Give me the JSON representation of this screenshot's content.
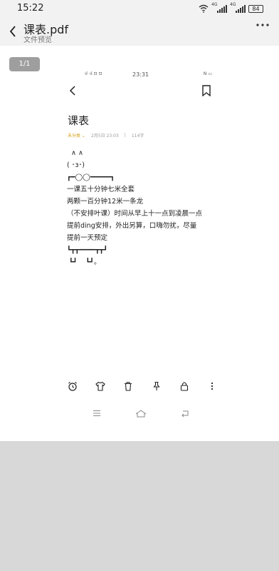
{
  "status_bar": {
    "time": "15:22",
    "signal_1_label": "4G",
    "signal_2_label": "4G",
    "battery": "84"
  },
  "header": {
    "title": "课表.pdf",
    "subtitle": "文件预览"
  },
  "page_indicator": "1/1",
  "inner_phone": {
    "status_time": "23:31",
    "status_left": "ᐧıl ᐧıl ⊡ ⊡",
    "status_right": "N ▭"
  },
  "note": {
    "title": "课表",
    "category": "未分类",
    "date": "2月5日 23:03",
    "separator": "|",
    "word_count": "114字",
    "lines": [
      "  ∧ ∧",
      "( ･з･)",
      "┏━◯◯━━━━━┓",
      "一课五十分钟七米全套",
      "两颗一百分钟12米一条龙",
      "（不安排叶课）时间从早上十一点到凌晨一点",
      "提前ding安排，外出另算，口嗨勿扰，尽量",
      "提前一天预定",
      "┗┳┳━━━━┳┳┛",
      " ┗┛    ┗┛。"
    ]
  },
  "icons": {
    "back": "back-arrow-icon",
    "more": "more-icon",
    "bookmark": "bookmark-icon",
    "alarm": "alarm-icon",
    "shirt": "shirt-icon",
    "trash": "trash-icon",
    "pin": "pin-icon",
    "lock": "lock-icon",
    "menu": "more-vertical-icon"
  },
  "colors": {
    "page_bg": "#ffffff",
    "chrome_bg": "#f2f2f2",
    "badge_bg": "#9e9e9e",
    "category": "#d4a017"
  }
}
